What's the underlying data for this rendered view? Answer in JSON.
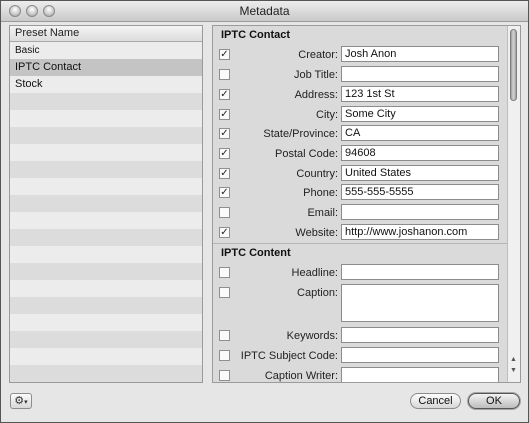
{
  "window": {
    "title": "Metadata"
  },
  "presets": {
    "header": "Preset Name",
    "items": [
      {
        "label": "Basic"
      },
      {
        "label": "IPTC Contact",
        "selected": true
      },
      {
        "label": "Stock"
      }
    ]
  },
  "iptc_contact": {
    "title": "IPTC Contact",
    "fields": [
      {
        "label": "Creator:",
        "value": "Josh Anon",
        "checked": true
      },
      {
        "label": "Job Title:",
        "value": "",
        "checked": false
      },
      {
        "label": "Address:",
        "value": "123 1st St",
        "checked": true
      },
      {
        "label": "City:",
        "value": "Some City",
        "checked": true
      },
      {
        "label": "State/Province:",
        "value": "CA",
        "checked": true
      },
      {
        "label": "Postal Code:",
        "value": "94608",
        "checked": true
      },
      {
        "label": "Country:",
        "value": "United States",
        "checked": true
      },
      {
        "label": "Phone:",
        "value": "555-555-5555",
        "checked": true
      },
      {
        "label": "Email:",
        "value": "",
        "checked": false
      },
      {
        "label": "Website:",
        "value": "http://www.joshanon.com",
        "checked": true
      }
    ]
  },
  "iptc_content": {
    "title": "IPTC Content",
    "fields": [
      {
        "label": "Headline:",
        "value": "",
        "checked": false
      },
      {
        "label": "Caption:",
        "value": "",
        "checked": false
      },
      {
        "label": "Keywords:",
        "value": "",
        "checked": false
      },
      {
        "label": "IPTC Subject Code:",
        "value": "",
        "checked": false
      },
      {
        "label": "Caption Writer:",
        "value": "",
        "checked": false
      }
    ]
  },
  "buttons": {
    "cancel": "Cancel",
    "ok": "OK",
    "gear_icon": "gear-icon"
  }
}
